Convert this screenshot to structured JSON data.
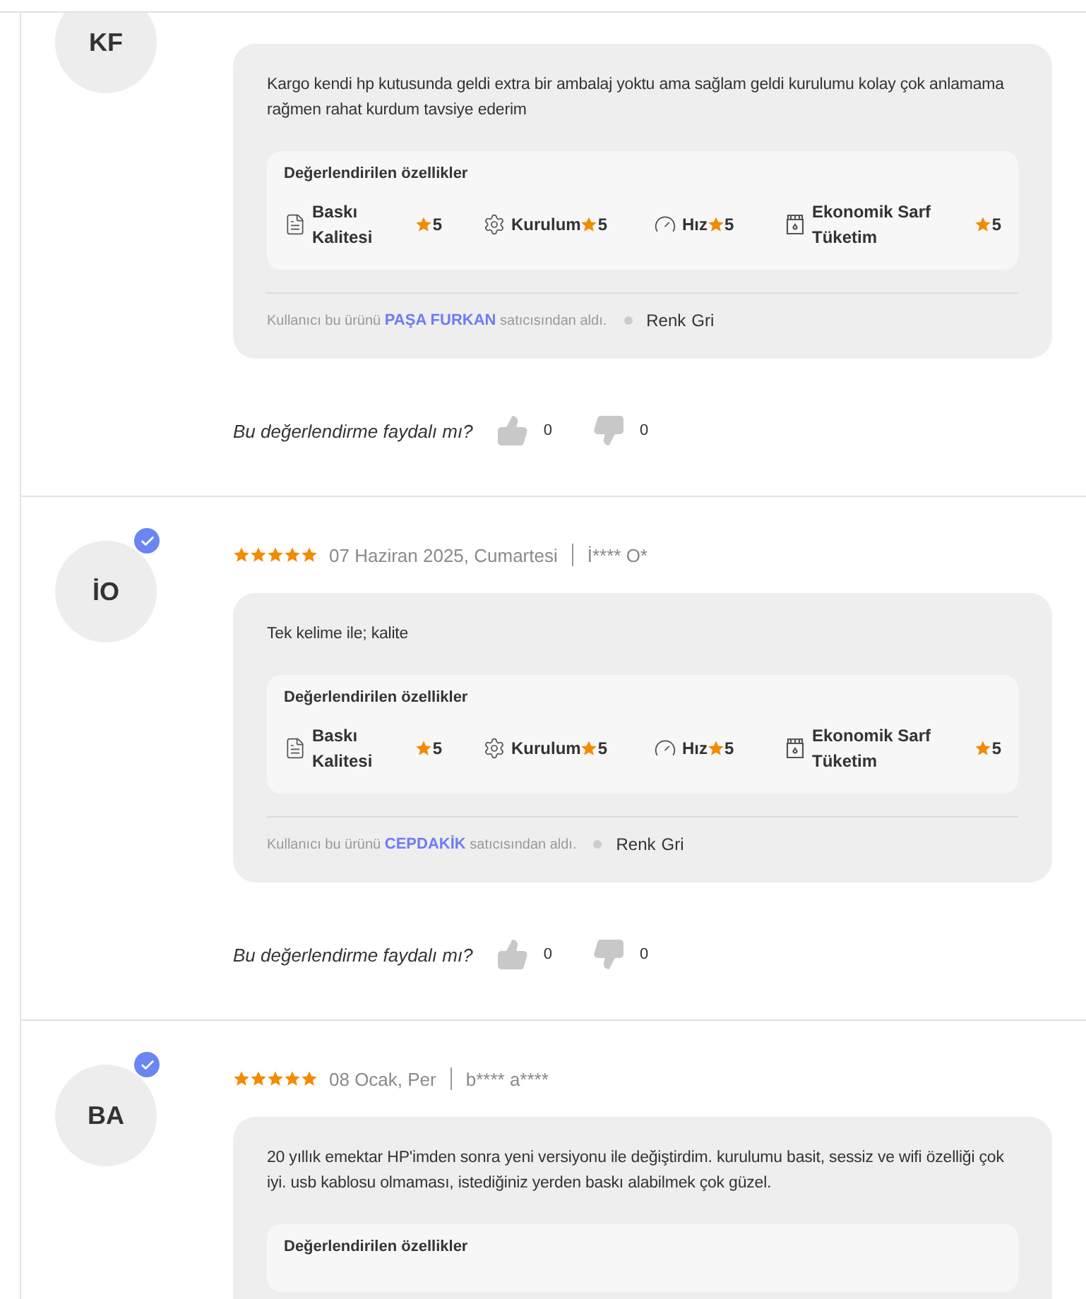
{
  "reviews": [
    {
      "initials": "KF",
      "text": "Kargo kendi hp kutusunda geldi extra bir ambalaj yoktu ama sağlam geldi kurulumu kolay çok anlamama rağmen rahat kurdum tavsiye ederim",
      "features_title": "Değerlendirilen özellikler",
      "features": [
        {
          "kind": "print",
          "name": "Baskı Kalitesi",
          "value": "5"
        },
        {
          "kind": "setup",
          "name": "Kurulum",
          "value": "5"
        },
        {
          "kind": "speed",
          "name": "Hız",
          "value": "5"
        },
        {
          "kind": "ink",
          "name": "Ekonomik Sarf Tüketim",
          "value": "5"
        }
      ],
      "seller": {
        "before": "Kullanıcı bu ürünü",
        "name": "PAŞA FURKAN",
        "after": "satıcısından aldı."
      },
      "attribute": {
        "label": "Renk",
        "value": "Gri"
      },
      "helpful": {
        "question": "Bu değerlendirme faydalı mı?",
        "likes": "0",
        "dislikes": "0"
      }
    },
    {
      "initials": "İO",
      "verified": true,
      "stars": 5,
      "date": "07 Haziran 2025, Cumartesi",
      "user": "İ**** O*",
      "text": "Tek kelime ile; kalite",
      "features_title": "Değerlendirilen özellikler",
      "features": [
        {
          "kind": "print",
          "name": "Baskı Kalitesi",
          "value": "5"
        },
        {
          "kind": "setup",
          "name": "Kurulum",
          "value": "5"
        },
        {
          "kind": "speed",
          "name": "Hız",
          "value": "5"
        },
        {
          "kind": "ink",
          "name": "Ekonomik Sarf Tüketim",
          "value": "5"
        }
      ],
      "seller": {
        "before": "Kullanıcı bu ürünü",
        "name": "CEPDAKİK",
        "after": "satıcısından aldı."
      },
      "attribute": {
        "label": "Renk",
        "value": "Gri"
      },
      "helpful": {
        "question": "Bu değerlendirme faydalı mı?",
        "likes": "0",
        "dislikes": "0"
      }
    },
    {
      "initials": "BA",
      "verified": true,
      "stars": 5,
      "date": "08 Ocak, Per",
      "user": "b**** a****",
      "text": "20 yıllık emektar HP'imden sonra yeni versiyonu ile değiştirdim. kurulumu basit, sessiz ve wifi özelliği çok iyi. usb kablosu olmaması, istediğiniz yerden baskı alabilmek çok güzel.",
      "features_title": "Değerlendirilen özellikler"
    }
  ]
}
